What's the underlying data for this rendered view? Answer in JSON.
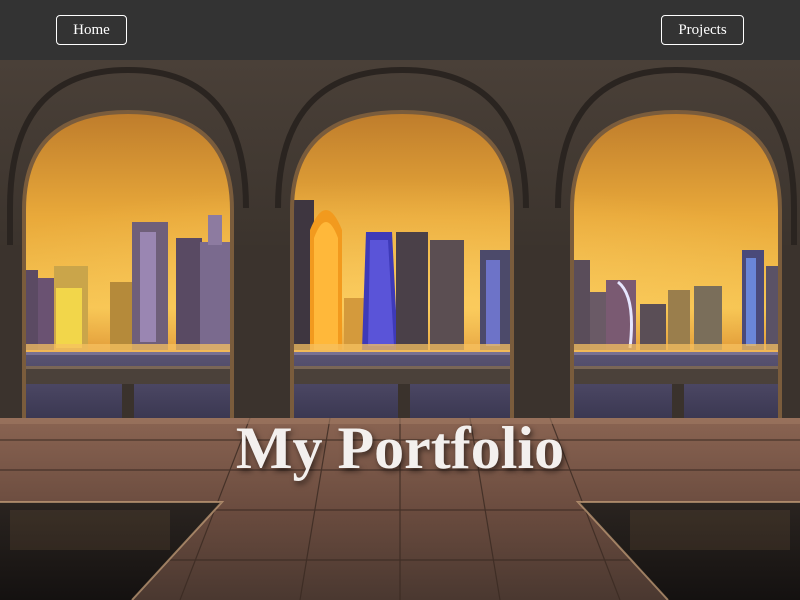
{
  "nav": {
    "home_label": "Home",
    "projects_label": "Projects"
  },
  "hero": {
    "title": "My Portfolio"
  },
  "colors": {
    "navbar": "#333333",
    "nav_button_border": "#ffffff",
    "title_text": "#f3f0ee",
    "sky_top": "#c8892a",
    "sky_glow": "#f5c24a",
    "arch_stone": "#3a332d",
    "floor": "#6b4e3e"
  }
}
